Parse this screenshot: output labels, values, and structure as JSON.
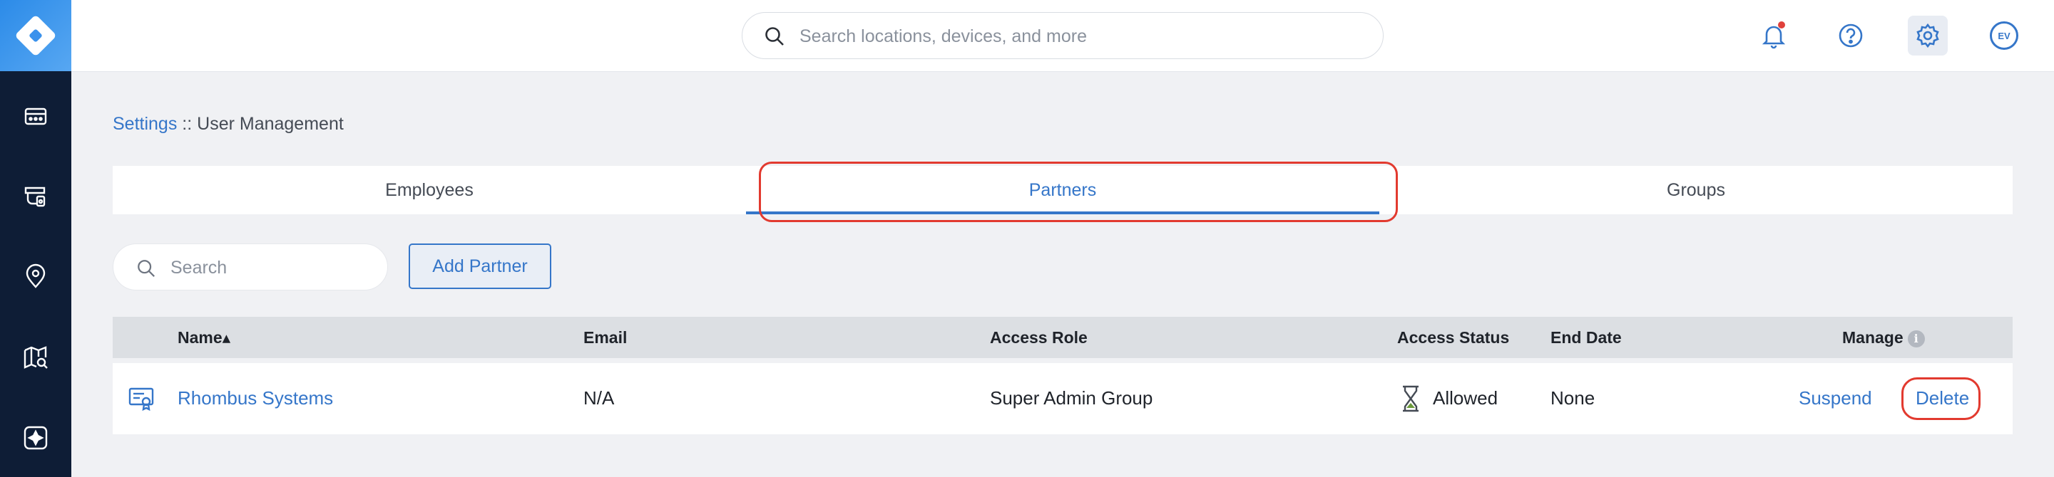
{
  "sidebar": {
    "items": [
      {
        "icon": "devices-icon"
      },
      {
        "icon": "camera-icon"
      },
      {
        "icon": "location-pin-icon"
      },
      {
        "icon": "map-search-icon"
      },
      {
        "icon": "integrations-icon"
      }
    ]
  },
  "topbar": {
    "search_placeholder": "Search locations, devices, and more",
    "avatar_initials": "EV"
  },
  "breadcrumb": {
    "root": "Settings",
    "separator": " :: ",
    "current": "User Management"
  },
  "tabs": [
    {
      "label": "Employees",
      "active": false
    },
    {
      "label": "Partners",
      "active": true
    },
    {
      "label": "Groups",
      "active": false
    }
  ],
  "filters": {
    "search_placeholder": "Search",
    "add_button": "Add Partner"
  },
  "table": {
    "columns": {
      "name": "Name▴",
      "email": "Email",
      "access_role": "Access Role",
      "access_status": "Access Status",
      "end_date": "End Date",
      "manage": "Manage"
    },
    "rows": [
      {
        "name": "Rhombus Systems",
        "email": "N/A",
        "access_role": "Super Admin Group",
        "access_status": "Allowed",
        "end_date": "None",
        "suspend": "Suspend",
        "delete": "Delete"
      }
    ]
  },
  "colors": {
    "accent": "#3576c9",
    "sidebar": "#0e1d36",
    "highlight": "#e23a2f"
  }
}
